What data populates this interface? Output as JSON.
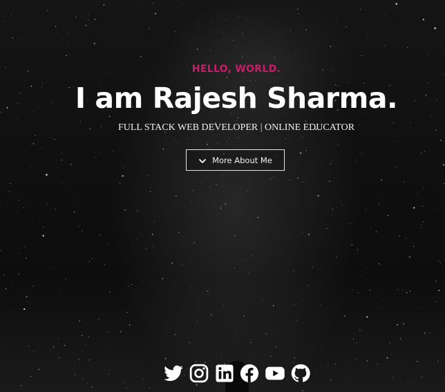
{
  "hero": {
    "greeting": "HELLO, WORLD.",
    "name": "I am Rajesh Sharma.",
    "tagline": "FULL STACK WEB DEVELOPER | ONLINE EDUCATOR",
    "cta_label": "More About Me",
    "cta_icon": "chevron-down-icon"
  },
  "socials": [
    {
      "icon": "twitter-icon"
    },
    {
      "icon": "instagram-icon"
    },
    {
      "icon": "linkedin-icon"
    },
    {
      "icon": "facebook-icon"
    },
    {
      "icon": "youtube-icon"
    },
    {
      "icon": "github-icon"
    }
  ],
  "colors": {
    "accent": "#c81e6a",
    "text": "#ffffff",
    "background": "#0e0e0e"
  }
}
